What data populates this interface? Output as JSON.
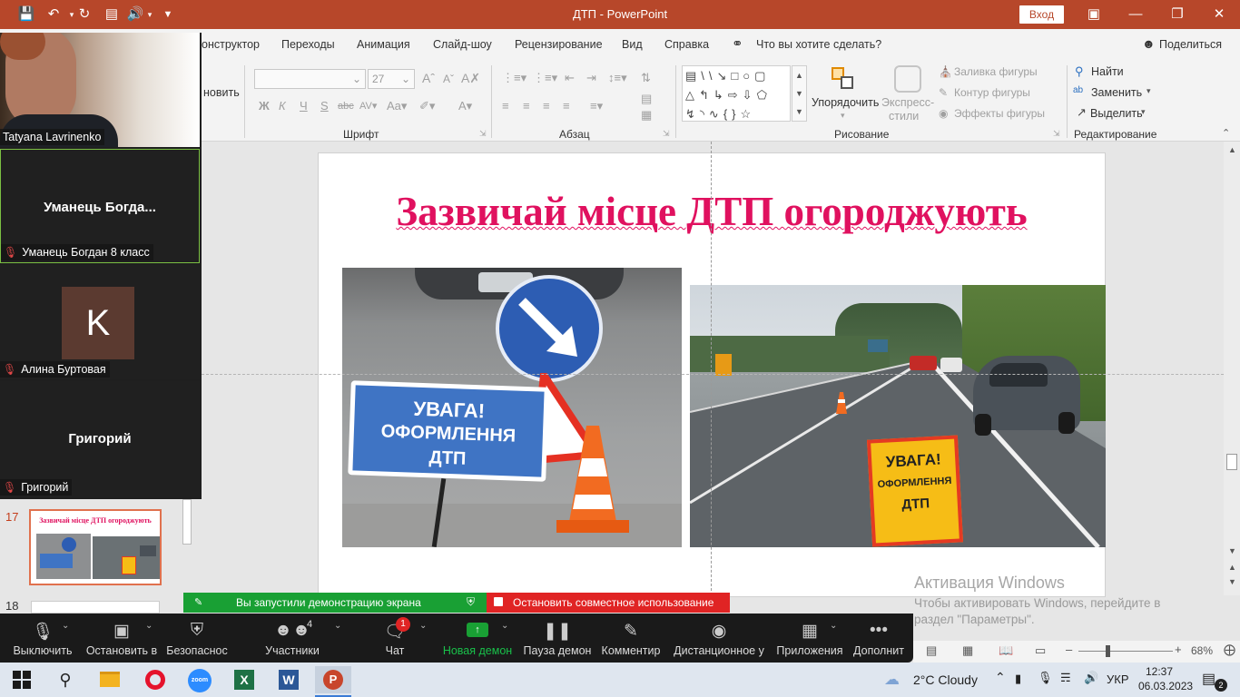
{
  "window": {
    "title": "ДТП - PowerPoint",
    "signin": "Вход"
  },
  "tabs": [
    "онструктор",
    "Переходы",
    "Анимация",
    "Слайд-шоу",
    "Рецензирование",
    "Вид",
    "Справка"
  ],
  "tell_me": "Что вы хотите сделать?",
  "share": "Поделиться",
  "ribbon": {
    "create_partial": "новить",
    "font_size": "27",
    "group_font": "Шрифт",
    "group_paragraph": "Абзац",
    "group_drawing": "Рисование",
    "group_editing": "Редактирование",
    "arrange": "Упорядочить",
    "quick_styles": [
      "Экспресс-",
      "стили"
    ],
    "fill": "Заливка фигуры",
    "outline": "Контур фигуры",
    "effects": "Эффекты фигуры",
    "find": "Найти",
    "replace": "Заменить",
    "select": "Выделить"
  },
  "slide": {
    "title": "Зазвичай місце ДТП огороджують"
  },
  "signs": {
    "left_sign": [
      "УВАГА!",
      "ОФОРМЛЕННЯ",
      "ДТП"
    ],
    "right_sign": [
      "УВАГА!",
      "ОФОРМЛЕННЯ",
      "ДТП"
    ]
  },
  "participants": [
    {
      "name": "Tatyana Lavrinenko"
    },
    {
      "display": "Уманець  Богда...",
      "name": "Уманець Богдан 8 класс"
    },
    {
      "initial": "K",
      "name": "Алина Буртовая"
    },
    {
      "display": "Григорий",
      "name": "Григорий"
    }
  ],
  "thumbnails": [
    {
      "num": "17",
      "title": "Зазвичай місце ДТП огороджують"
    },
    {
      "num": "18"
    }
  ],
  "share_banner": {
    "started": "Вы запустили демонстрацию экрана",
    "stop": "Остановить совместное использование"
  },
  "zoom_toolbar": {
    "mute": "Выключить",
    "video": "Остановить в",
    "security": "Безопаснос",
    "participants": "Участники",
    "participants_count": "4",
    "chat": "Чат",
    "chat_badge": "1",
    "new_share": "Новая демон",
    "pause_share": "Пауза демон",
    "annotate": "Комментир",
    "remote": "Дистанционное у",
    "apps": "Приложения",
    "more": "Дополнит"
  },
  "activation": {
    "title": "Активация Windows",
    "line1": "Чтобы активировать Windows, перейдите в",
    "line2": "раздел \"Параметры\"."
  },
  "statusbar": {
    "zoom": "68%"
  },
  "taskbar": {
    "weather": "2°C  Cloudy",
    "lang": "УКР",
    "time": "12:37",
    "date": "06.03.2023",
    "notif": "2"
  }
}
